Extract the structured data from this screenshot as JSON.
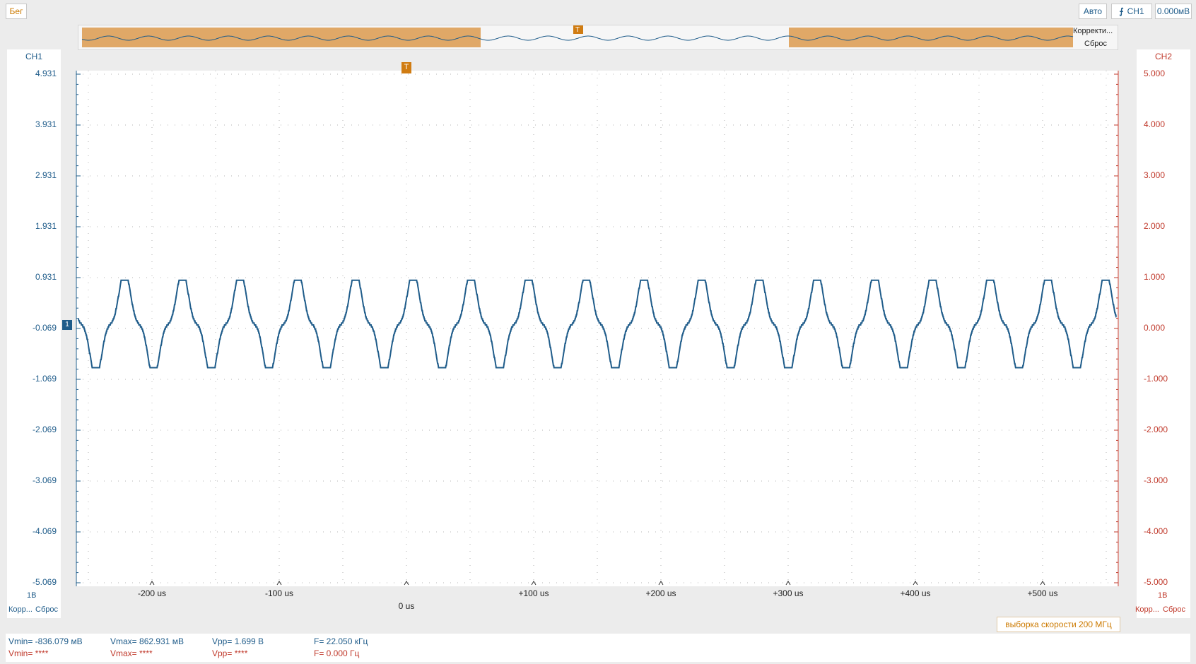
{
  "status": {
    "run_label": "Бег"
  },
  "trigger": {
    "mode": "Авто",
    "source": "CH1",
    "level": "0.000мВ"
  },
  "overview": {
    "correction": "Корректи...",
    "reset": "Сброс"
  },
  "ch1": {
    "name": "CH1",
    "scale": "1В",
    "corr": "Корр...",
    "reset": "Сброс",
    "ticks": [
      "4.931",
      "3.931",
      "2.931",
      "1.931",
      "0.931",
      "-0.069",
      "-1.069",
      "-2.069",
      "-3.069",
      "-4.069",
      "-5.069"
    ],
    "color": "#1f5c8a"
  },
  "ch2": {
    "name": "CH2",
    "scale": "1В",
    "corr": "Корр...",
    "reset": "Сброс",
    "ticks": [
      "5.000",
      "4.000",
      "3.000",
      "2.000",
      "1.000",
      "0.000",
      "-1.000",
      "-2.000",
      "-3.000",
      "-4.000",
      "-5.000"
    ],
    "color": "#c0392b"
  },
  "xaxis": {
    "ticks": [
      "-200 us",
      "-100 us",
      "",
      "+100 us",
      "+200 us",
      "+300 us",
      "+400 us",
      "+500 us"
    ],
    "origin_label": "0 us"
  },
  "sample_rate": "выборка скорости 200 МГц",
  "measurements": {
    "ch1": {
      "vmin": "Vmin= -836.079 мВ",
      "vmax": "Vmax= 862.931 мВ",
      "vpp": "Vpp= 1.699 В",
      "freq": "F= 22.050 кГц"
    },
    "ch2": {
      "vmin": "Vmin= ****",
      "vmax": "Vmax= ****",
      "vpp": "Vpp= ****",
      "freq": "F= 0.000 Гц"
    }
  },
  "chart_data": {
    "type": "line",
    "x_unit": "us",
    "xlim": [
      -260,
      560
    ],
    "ylim": [
      -5.069,
      4.931
    ],
    "series": [
      {
        "frequency_khz": 22.05,
        "vmin_v": -0.836,
        "vmax_v": 0.863
      }
    ]
  }
}
